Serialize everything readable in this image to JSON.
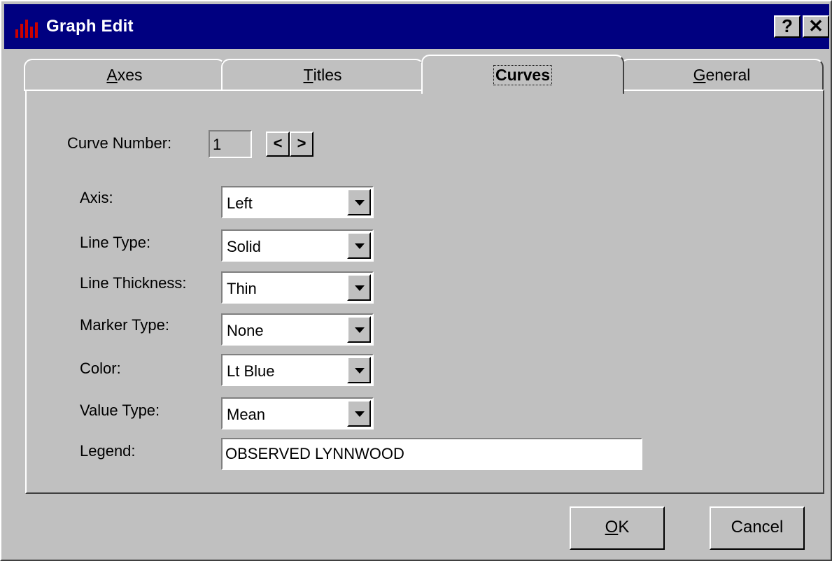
{
  "window": {
    "title": "Graph Edit",
    "help_label": "?",
    "close_label": "✕"
  },
  "tabs": [
    {
      "mnemonic": "A",
      "rest": "xes"
    },
    {
      "mnemonic": "T",
      "rest": "itles"
    },
    {
      "label": "Curves"
    },
    {
      "mnemonic": "G",
      "rest": "eneral"
    }
  ],
  "curve": {
    "label": "Curve Number:",
    "value": "1",
    "prev": "<",
    "next": ">"
  },
  "fields": {
    "axis": {
      "label": "Axis:",
      "value": "Left"
    },
    "line_type": {
      "label": "Line Type:",
      "value": "Solid"
    },
    "line_thickness": {
      "label": "Line Thickness:",
      "value": "Thin"
    },
    "marker_type": {
      "label": "Marker Type:",
      "value": "None"
    },
    "color": {
      "label": "Color:",
      "value": "Lt Blue"
    },
    "value_type": {
      "label": "Value Type:",
      "value": "Mean"
    },
    "legend": {
      "label": "Legend:",
      "value": "OBSERVED LYNNWOOD"
    }
  },
  "buttons": {
    "ok_mnemonic": "O",
    "ok_rest": "K",
    "cancel": "Cancel"
  },
  "colors": {
    "titlebar": "#000080",
    "face": "#c0c0c0",
    "icon": "#cc0000"
  }
}
